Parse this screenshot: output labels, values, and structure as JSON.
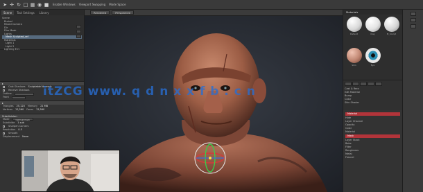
{
  "toolbar": {
    "menu_items": [
      "Enable Windows",
      "Viewport Swapping",
      "Mode Space"
    ]
  },
  "left_panel": {
    "tabs": [
      "Scene",
      "Tool Settings",
      "Library"
    ],
    "tree_items": [
      "Scene",
      "Buried",
      "Mixed Camera",
      "Dir",
      "Dirs Mask",
      "Lights",
      "Mesh Sculpted_ref",
      "Materials",
      "Light 1",
      "Light 2",
      "Lighting Env",
      "Pose",
      "Head Skin"
    ],
    "selected_tree_index": 6,
    "sections": {
      "cast_shadows": "Cast Shadows",
      "receive_shadows": "Receive Shadows",
      "visibility": "Sculptable Normals",
      "outline_label": "Outline",
      "front": "Front",
      "triangles": "Triangles",
      "triangles_val": "25,120",
      "vertices": "Vertices",
      "vertices_val": "12,560",
      "memory": "Memory",
      "memory_val": "21 MB",
      "faces": "Faces",
      "faces_val": "12,560",
      "subdiv_header": "Subdivision",
      "mode_label": "Mode",
      "mode_value": "Catmull-Clark",
      "subdivide": "Subdivide",
      "subdivide_val": "1 sub",
      "sharpen": "Sharpen Corners",
      "resolution": "Resolution",
      "resolution_val": "0.5",
      "smooth": "Smooth",
      "displacement": "Displacement",
      "displacement_val": "None"
    }
  },
  "viewport": {
    "dropdown_1": "Rendered",
    "dropdown_2": "Perspective"
  },
  "right_panel": {
    "title": "Materials",
    "materials": [
      {
        "label": "Default",
        "color": "#e8e8e8"
      },
      {
        "label": "Clay",
        "color": "#f0f0f0"
      },
      {
        "label": "M_Sculpt",
        "color": "#e6e6e6"
      },
      {
        "label": "Skin",
        "color": "#c89585"
      },
      {
        "label": "Eye",
        "color": "#2f88a8"
      },
      {
        "label": "",
        "color": ""
      }
    ],
    "tool_rows": [
      "Cast & Recv",
      "Edit Material",
      "Bump",
      "Color",
      "Skin Shader"
    ],
    "active_row": "Material",
    "list_items": [
      "Hide",
      "Layer Channel",
      "Opacity",
      "Color",
      "Material",
      "Mask",
      "Layer Stack",
      "Bake",
      "Filter",
      "Roughness",
      "Metal",
      "Fresnel"
    ]
  },
  "watermark": "WWW.QDNXXFB.CN",
  "watermark_display": "itZCG  www. q d n x x f b . c n"
}
